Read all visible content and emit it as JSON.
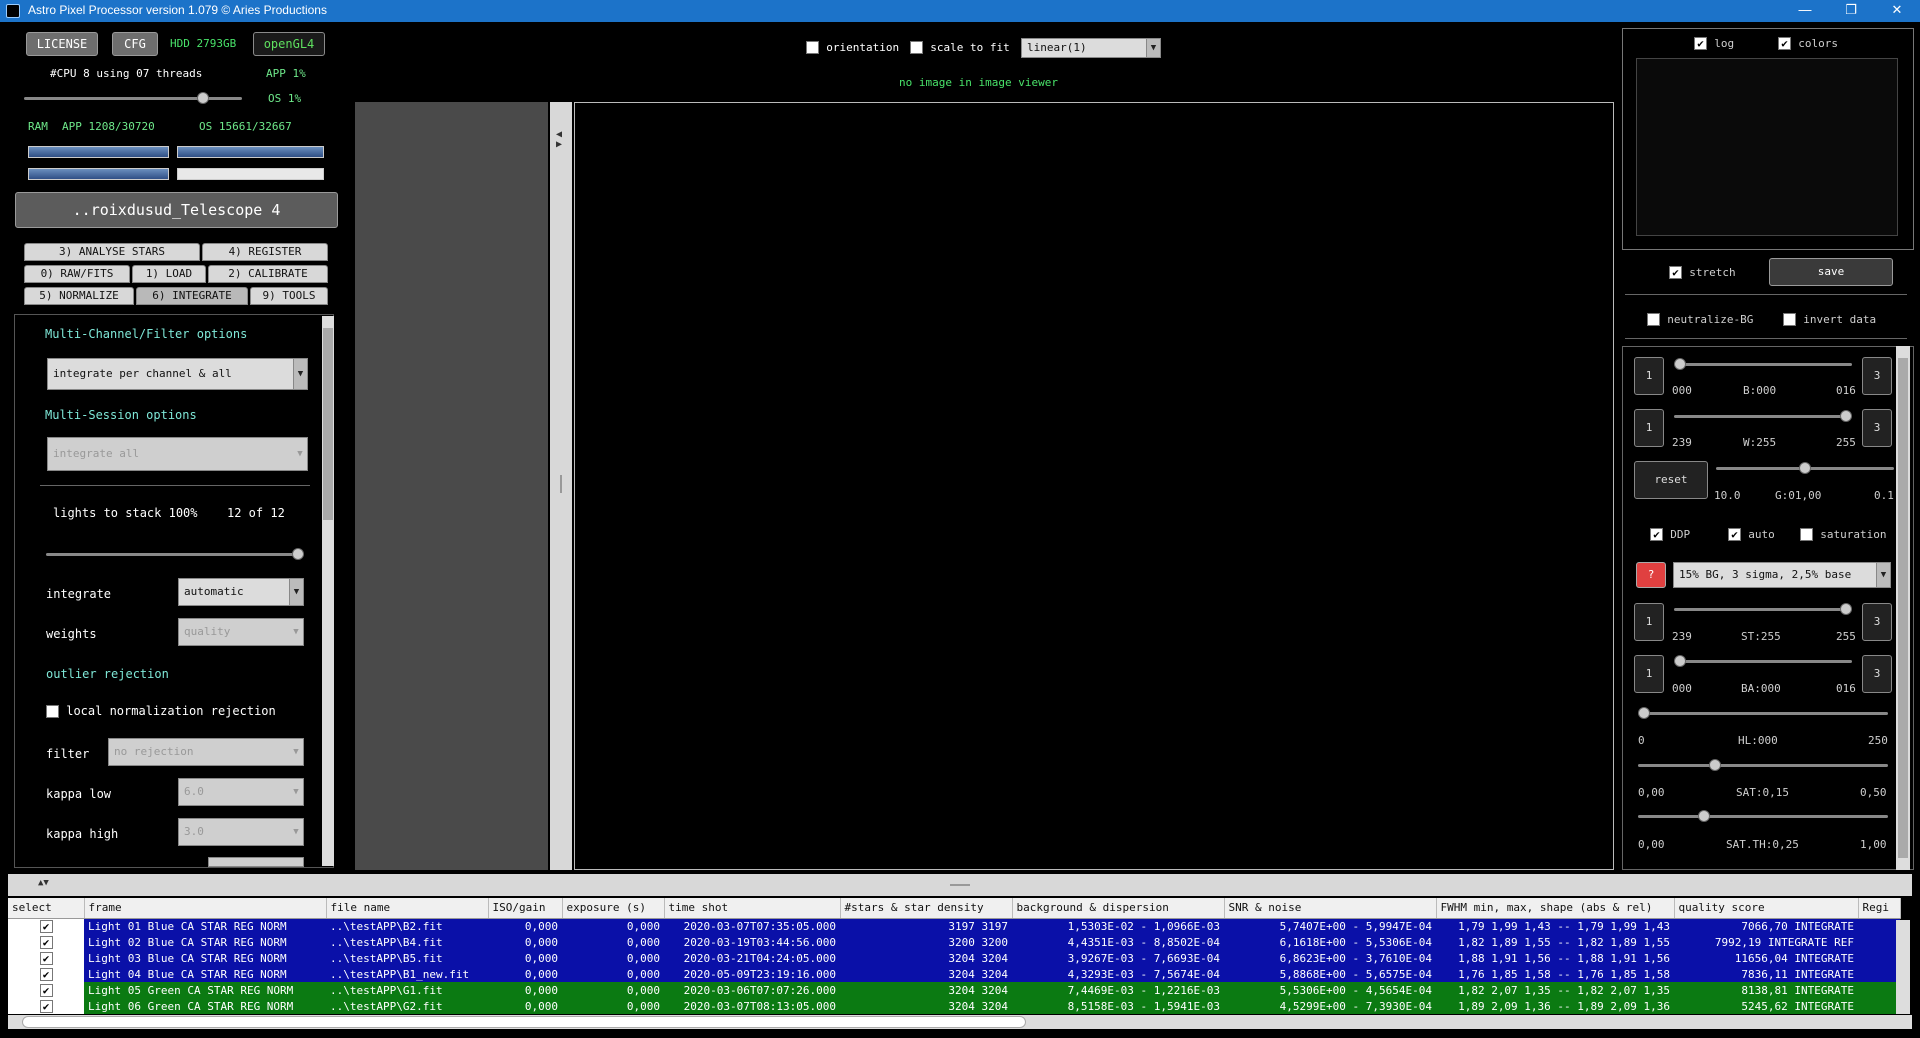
{
  "window": {
    "title": "Astro Pixel Processor version 1.079 © Aries Productions"
  },
  "top_buttons": {
    "license": "LICENSE",
    "cfg": "CFG",
    "hdd": "HDD 2793GB",
    "opengl": "openGL4"
  },
  "cpu": {
    "threads_text": "#CPU 8  using 07 threads",
    "app": "APP 1%",
    "os": "OS 1%",
    "threads_fraction": 0.84
  },
  "ram": {
    "label": "RAM",
    "app": "APP 1208/30720",
    "os": "OS 15661/32667"
  },
  "config_name": "..roixdusud_Telescope 4",
  "tabs": {
    "row1": [
      "3) ANALYSE STARS",
      "4) REGISTER"
    ],
    "row2": [
      "0) RAW/FITS",
      "1) LOAD",
      "2) CALIBRATE"
    ],
    "row3": [
      "5) NORMALIZE",
      "6) INTEGRATE",
      "9) TOOLS"
    ]
  },
  "integrate": {
    "multichannel_label": "Multi-Channel/Filter options",
    "multichannel_value": "integrate per channel & all",
    "multisession_label": "Multi-Session options",
    "multisession_value": "integrate all",
    "lights_label": "lights to stack 100%",
    "lights_count": "12 of 12",
    "lights_fraction": 1.0,
    "integrate_label": "integrate",
    "integrate_value": "automatic",
    "weights_label": "weights",
    "weights_value": "quality",
    "outlier_label": "outlier rejection",
    "lnr_label": "local normalization rejection",
    "filter_label": "filter",
    "filter_value": "no rejection",
    "kappa_low_label": "kappa low",
    "kappa_low_value": "6.0",
    "kappa_high_label": "kappa high",
    "kappa_high_value": "3.0"
  },
  "viewer": {
    "orientation": "orientation",
    "scale_to_fit": "scale to fit",
    "mode": "linear(1)",
    "status": "no image in image viewer"
  },
  "right": {
    "log": "log",
    "colors": "colors",
    "stretch": "stretch",
    "save": "save",
    "neutralize": "neutralize-BG",
    "invert": "invert data",
    "b": {
      "min": "000",
      "label": "B:000",
      "max": "016",
      "fraction": 0.0
    },
    "w": {
      "min": "239",
      "label": "W:255",
      "max": "255",
      "fraction": 1.0
    },
    "reset": "reset",
    "g": {
      "min": "10.0",
      "label": "G:01,00",
      "max": "0.1",
      "fraction": 0.5
    },
    "ddp": "DDP",
    "auto": "auto",
    "saturation": "saturation",
    "preset": "15% BG, 3 sigma, 2,5% base",
    "st": {
      "min": "239",
      "label": "ST:255",
      "max": "255",
      "fraction": 1.0
    },
    "ba": {
      "min": "000",
      "label": "BA:000",
      "max": "016",
      "fraction": 0.0
    },
    "hl": {
      "min": "0",
      "label": "HL:000",
      "max": "250",
      "fraction": 0.0
    },
    "sat": {
      "min": "0,00",
      "label": "SAT:0,15",
      "max": "0,50",
      "fraction": 0.3
    },
    "satth": {
      "min": "0,00",
      "label": "SAT.TH:0,25",
      "max": "1,00",
      "fraction": 0.25
    },
    "step_left": "1",
    "step_right": "3",
    "question": "?"
  },
  "table": {
    "headers": [
      "select",
      "frame",
      "file name",
      "ISO/gain",
      "exposure (s)",
      "time shot",
      "#stars & star density",
      "background & dispersion",
      "SNR & noise",
      "FWHM min, max, shape (abs & rel)",
      "quality score",
      "Regi"
    ],
    "rows": [
      {
        "color": "blue",
        "frame": "Light 01 Blue  CA STAR REG NORM",
        "file": "..\\testAPP\\B2.fit",
        "iso": "0,000",
        "exp": "0,000",
        "time": "2020-03-07T07:35:05.000",
        "stars": "3197 3197",
        "bg": "1,5303E-02 -  1,0966E-03",
        "snr": "5,7407E+00 -  5,9947E-04",
        "fwhm": "1,79 1,99 1,43 -- 1,79 1,99 1,43",
        "quality": "7066,70 INTEGRATE"
      },
      {
        "color": "blue",
        "frame": "Light 02 Blue  CA STAR REG NORM",
        "file": "..\\testAPP\\B4.fit",
        "iso": "0,000",
        "exp": "0,000",
        "time": "2020-03-19T03:44:56.000",
        "stars": "3200 3200",
        "bg": "4,4351E-03 -  8,8502E-04",
        "snr": "6,1618E+00 -  5,5306E-04",
        "fwhm": "1,82 1,89 1,55 -- 1,82 1,89 1,55",
        "quality": "7992,19 INTEGRATE REF"
      },
      {
        "color": "blue",
        "frame": "Light 03 Blue  CA STAR REG NORM",
        "file": "..\\testAPP\\B5.fit",
        "iso": "0,000",
        "exp": "0,000",
        "time": "2020-03-21T04:24:05.000",
        "stars": "3204 3204",
        "bg": "3,9267E-03 -  7,6693E-04",
        "snr": "6,8623E+00 -  3,7610E-04",
        "fwhm": "1,88 1,91 1,56 -- 1,88 1,91 1,56",
        "quality": "11656,04 INTEGRATE"
      },
      {
        "color": "blue",
        "frame": "Light 04 Blue  CA STAR REG NORM",
        "file": "..\\testAPP\\B1_new.fit",
        "iso": "0,000",
        "exp": "0,000",
        "time": "2020-05-09T23:19:16.000",
        "stars": "3204 3204",
        "bg": "4,3293E-03 -  7,5674E-04",
        "snr": "5,8868E+00 -  5,6575E-04",
        "fwhm": "1,76 1,85 1,58 -- 1,76 1,85 1,58",
        "quality": "7836,11 INTEGRATE"
      },
      {
        "color": "green",
        "frame": "Light 05 Green  CA STAR REG NORM",
        "file": "..\\testAPP\\G1.fit",
        "iso": "0,000",
        "exp": "0,000",
        "time": "2020-03-06T07:07:26.000",
        "stars": "3204 3204",
        "bg": "7,4469E-03 -  1,2216E-03",
        "snr": "5,5306E+00 -  4,5654E-04",
        "fwhm": "1,82 2,07 1,35 -- 1,82 2,07 1,35",
        "quality": "8138,81 INTEGRATE"
      },
      {
        "color": "green",
        "frame": "Light 06 Green  CA STAR REG NORM",
        "file": "..\\testAPP\\G2.fit",
        "iso": "0,000",
        "exp": "0,000",
        "time": "2020-03-07T08:13:05.000",
        "stars": "3204 3204",
        "bg": "8,5158E-03 -  1,5941E-03",
        "snr": "4,5299E+00 -  7,3930E-04",
        "fwhm": "1,89 2,09 1,36 -- 1,89 2,09 1,36",
        "quality": "5245,62 INTEGRATE"
      }
    ]
  }
}
